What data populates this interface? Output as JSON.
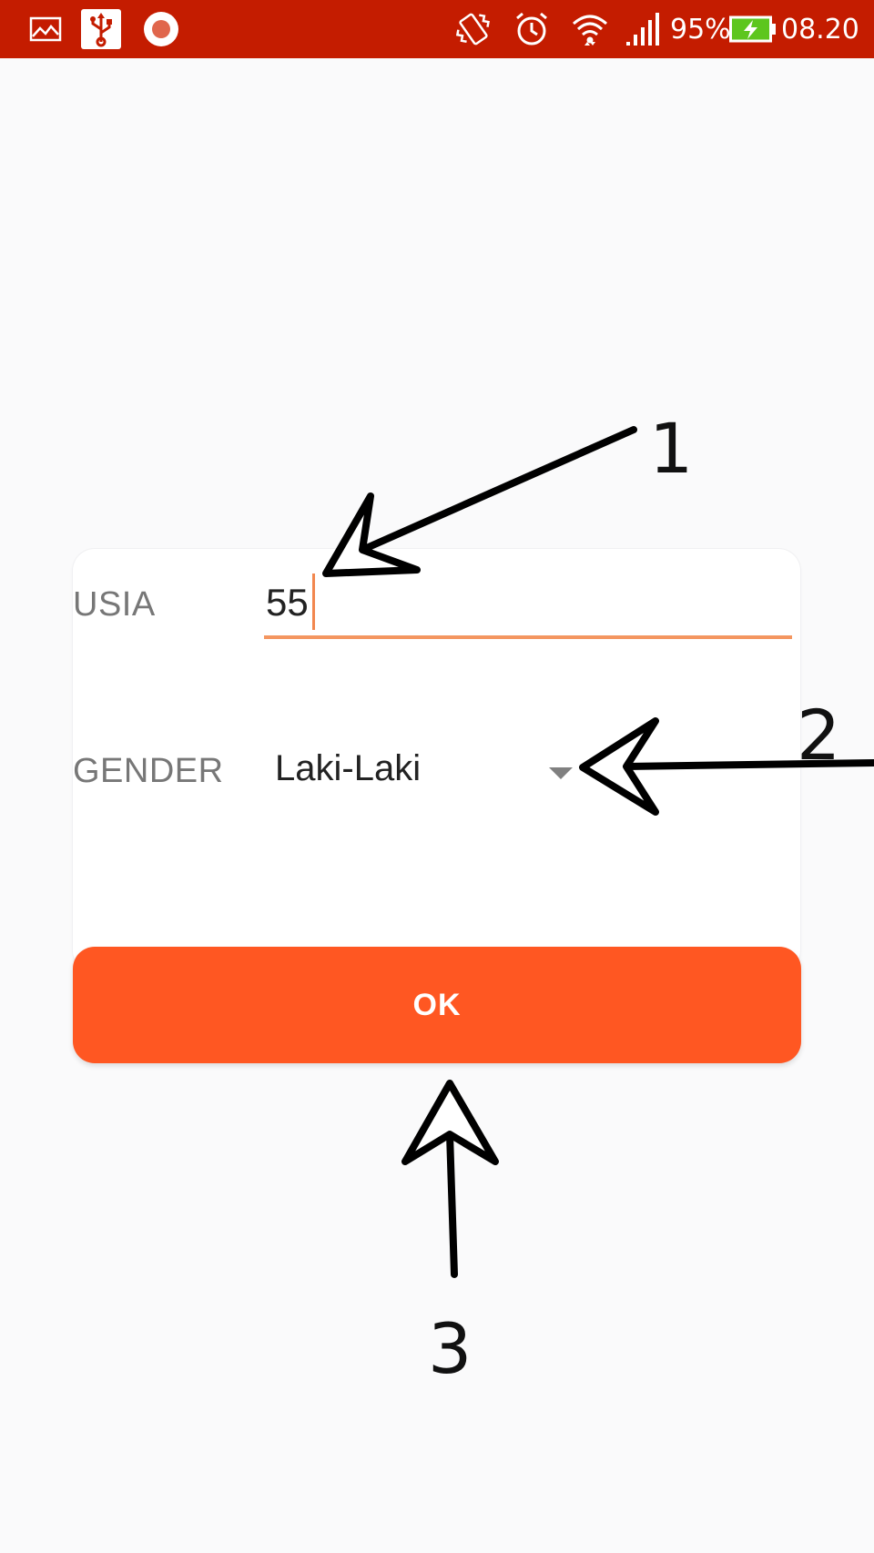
{
  "status_bar": {
    "battery_percent": "95%",
    "time": "08.20",
    "background_color": "#c41c00",
    "icons": [
      "gallery-icon",
      "usb-icon",
      "screen-record-icon",
      "vibrate-icon",
      "alarm-icon",
      "wifi-icon",
      "signal-icon",
      "battery-charging-icon"
    ]
  },
  "form": {
    "age_label": "USIA",
    "age_value": "55",
    "gender_label": "GENDER",
    "gender_selected": "Laki-Laki"
  },
  "ok_button": {
    "label": "OK",
    "color": "#ff5722"
  },
  "annotations": {
    "callout_1": "1",
    "callout_2": "2",
    "callout_3": "3"
  }
}
